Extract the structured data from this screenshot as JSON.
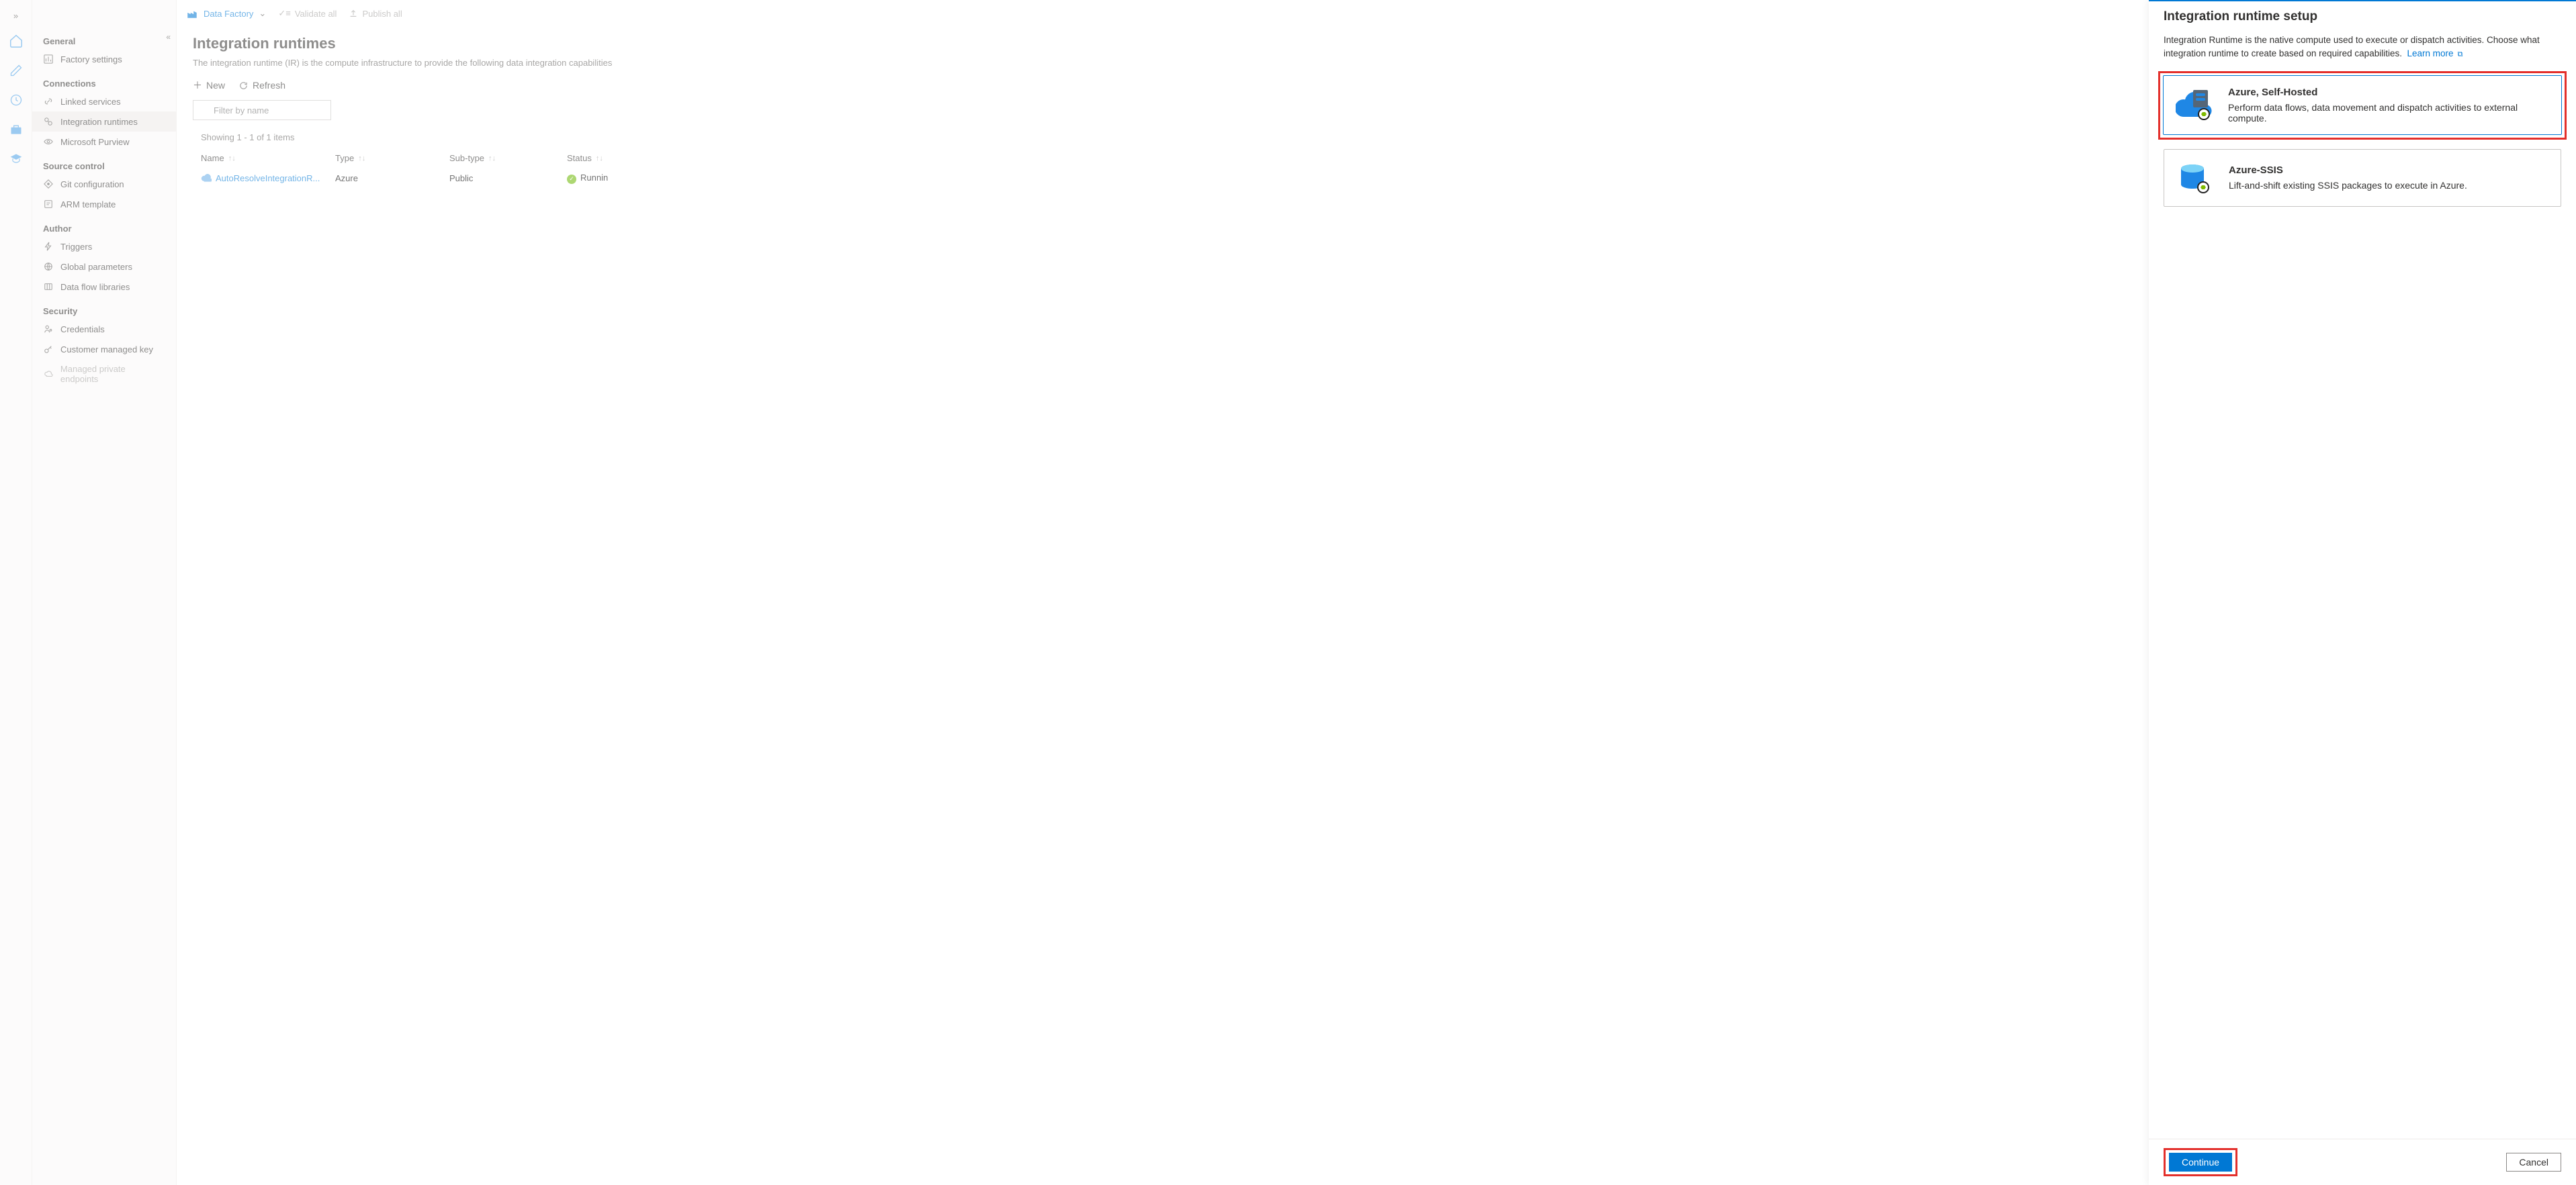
{
  "toolbar": {
    "brand": "Data Factory",
    "validate": "Validate all",
    "publish": "Publish all"
  },
  "sidebar": {
    "groups": {
      "general": {
        "label": "General",
        "items": [
          "Factory settings"
        ]
      },
      "connections": {
        "label": "Connections",
        "items": [
          "Linked services",
          "Integration runtimes",
          "Microsoft Purview"
        ]
      },
      "source_control": {
        "label": "Source control",
        "items": [
          "Git configuration",
          "ARM template"
        ]
      },
      "author": {
        "label": "Author",
        "items": [
          "Triggers",
          "Global parameters",
          "Data flow libraries"
        ]
      },
      "security": {
        "label": "Security",
        "items": [
          "Credentials",
          "Customer managed key",
          "Managed private endpoints"
        ]
      }
    }
  },
  "page": {
    "title": "Integration runtimes",
    "desc": "The integration runtime (IR) is the compute infrastructure to provide the following data integration capabilities",
    "new": "New",
    "refresh": "Refresh",
    "filter_placeholder": "Filter by name",
    "showing": "Showing 1 - 1 of 1 items",
    "cols": {
      "name": "Name",
      "type": "Type",
      "sub": "Sub-type",
      "status": "Status"
    },
    "row": {
      "name": "AutoResolveIntegrationR...",
      "type": "Azure",
      "sub": "Public",
      "status": "Runnin"
    }
  },
  "panel": {
    "title": "Integration runtime setup",
    "desc": "Integration Runtime is the native compute used to execute or dispatch activities. Choose what integration runtime to create based on required capabilities.",
    "learn_more": "Learn more",
    "options": [
      {
        "title": "Azure, Self-Hosted",
        "desc": "Perform data flows, data movement and dispatch activities to external compute."
      },
      {
        "title": "Azure-SSIS",
        "desc": "Lift-and-shift existing SSIS packages to execute in Azure."
      }
    ],
    "continue": "Continue",
    "cancel": "Cancel"
  }
}
